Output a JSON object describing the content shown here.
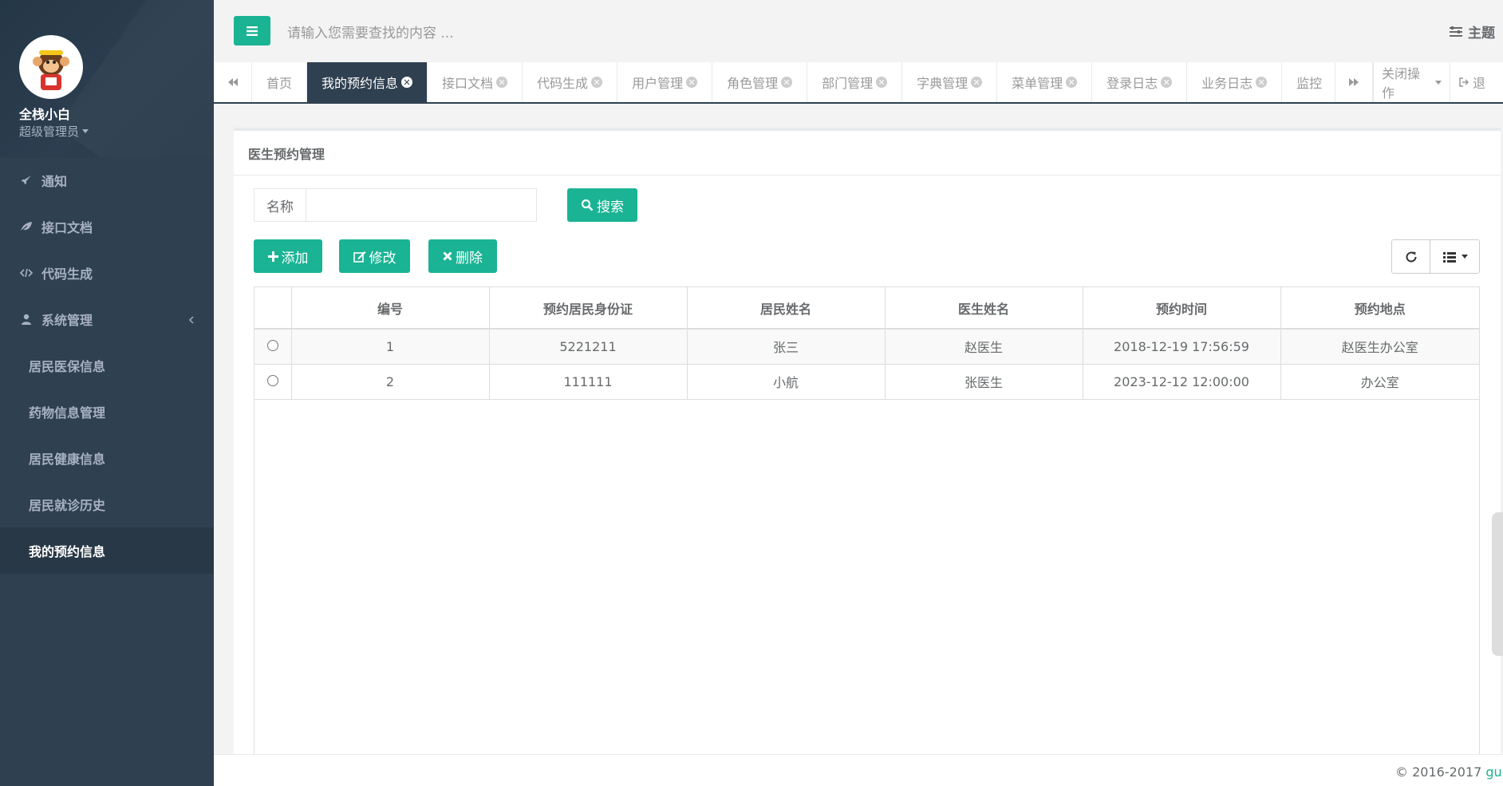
{
  "user": {
    "name": "全栈小白",
    "role": "超级管理员"
  },
  "sidebar": {
    "items": [
      {
        "label": "通知",
        "icon": "rocket-icon"
      },
      {
        "label": "接口文档",
        "icon": "leaf-icon"
      },
      {
        "label": "代码生成",
        "icon": "code-icon"
      },
      {
        "label": "系统管理",
        "icon": "user-icon"
      }
    ],
    "sub_items": [
      {
        "label": "居民医保信息"
      },
      {
        "label": "药物信息管理"
      },
      {
        "label": "居民健康信息"
      },
      {
        "label": "居民就诊历史"
      },
      {
        "label": "我的预约信息"
      }
    ]
  },
  "header": {
    "search_placeholder": "请输入您需要查找的内容 ...",
    "theme_label": "主题"
  },
  "tabs": [
    {
      "label": "首页",
      "closable": false
    },
    {
      "label": "我的预约信息",
      "closable": true,
      "active": true
    },
    {
      "label": "接口文档",
      "closable": true
    },
    {
      "label": "代码生成",
      "closable": true
    },
    {
      "label": "用户管理",
      "closable": true
    },
    {
      "label": "角色管理",
      "closable": true
    },
    {
      "label": "部门管理",
      "closable": true
    },
    {
      "label": "字典管理",
      "closable": true
    },
    {
      "label": "菜单管理",
      "closable": true
    },
    {
      "label": "登录日志",
      "closable": true
    },
    {
      "label": "业务日志",
      "closable": true
    },
    {
      "label": "监控",
      "closable": false
    }
  ],
  "tab_actions": {
    "close_ops": "关闭操作",
    "logout": "退"
  },
  "panel": {
    "title": "医生预约管理",
    "search_label": "名称",
    "search_value": "",
    "search_button": "搜索",
    "add_button": "添加",
    "edit_button": "修改",
    "delete_button": "删除"
  },
  "table": {
    "columns": [
      "编号",
      "预约居民身份证",
      "居民姓名",
      "医生姓名",
      "预约时间",
      "预约地点"
    ],
    "rows": [
      [
        "1",
        "5221211",
        "张三",
        "赵医生",
        "2018-12-19 17:56:59",
        "赵医生办公室"
      ],
      [
        "2",
        "111111",
        "小航",
        "张医生",
        "2023-12-12 12:00:00",
        "办公室"
      ]
    ]
  },
  "footer": {
    "copyright": "© 2016-2017 ",
    "link": "guns"
  },
  "colors": {
    "accent": "#1ab394",
    "sidebar": "#2f4050"
  }
}
